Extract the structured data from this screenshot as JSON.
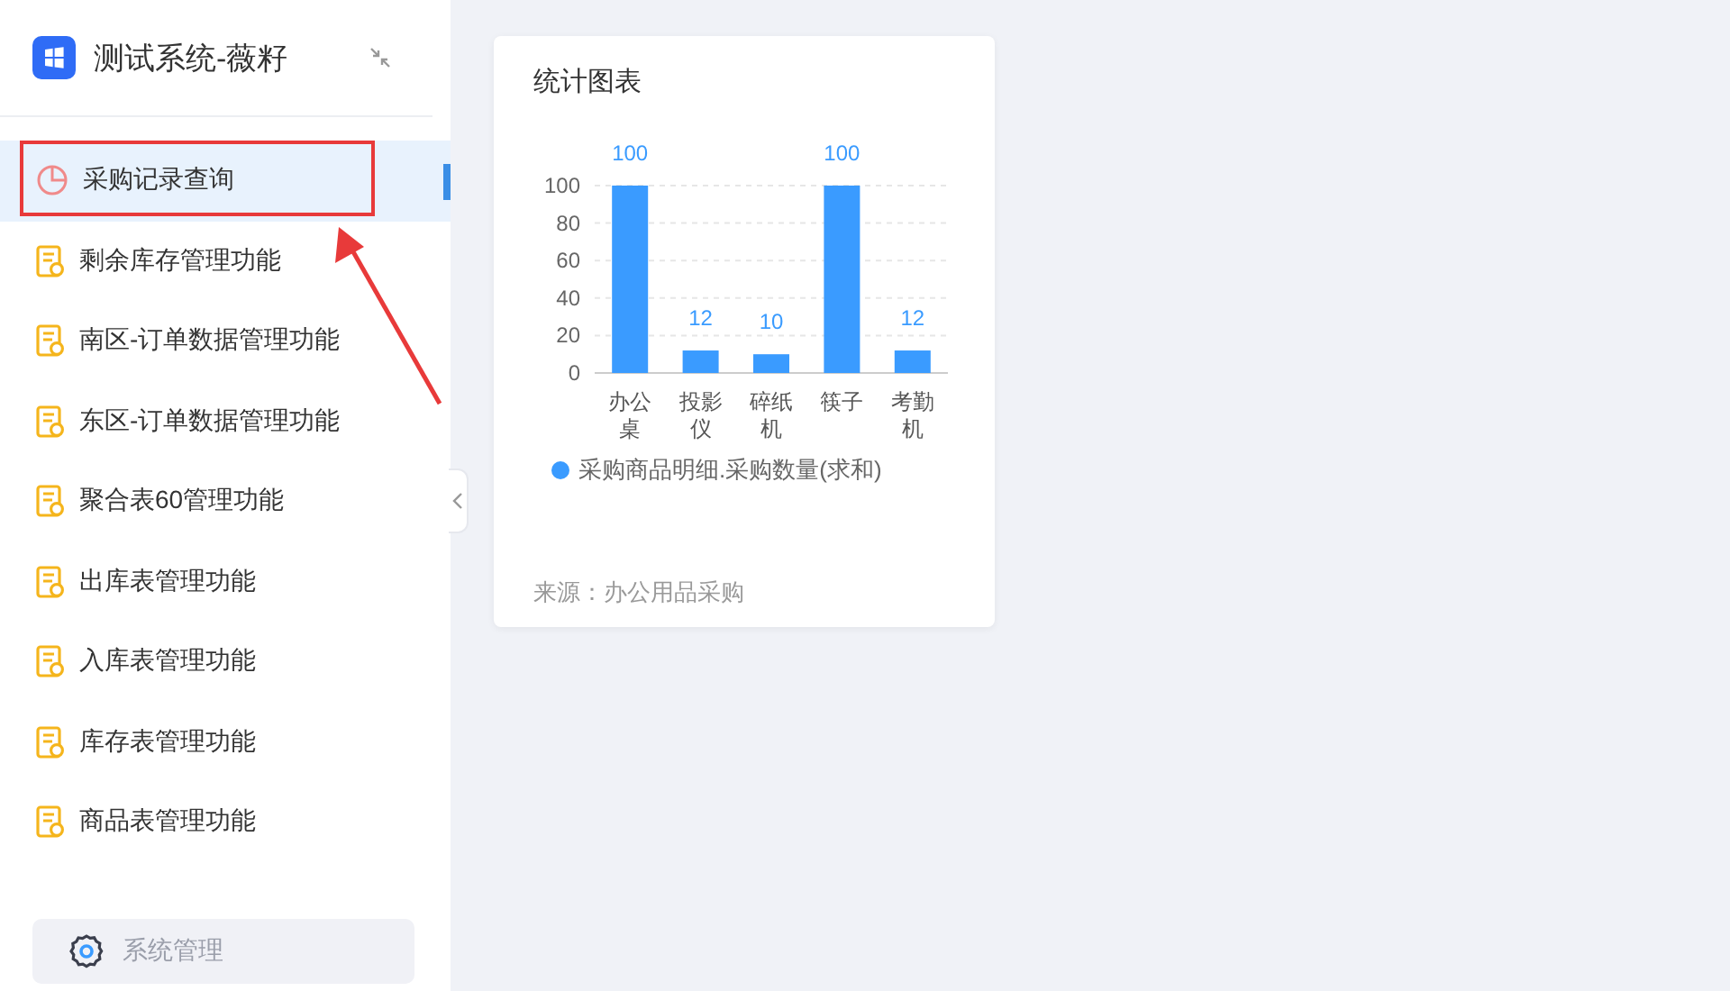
{
  "sidebar": {
    "app_title": "测试系统-薇籽",
    "items": [
      {
        "label": "采购记录查询",
        "kind": "chart",
        "selected": true
      },
      {
        "label": "剩余库存管理功能",
        "kind": "form",
        "selected": false
      },
      {
        "label": "南区-订单数据管理功能",
        "kind": "form",
        "selected": false
      },
      {
        "label": "东区-订单数据管理功能",
        "kind": "form",
        "selected": false
      },
      {
        "label": "聚合表60管理功能",
        "kind": "form",
        "selected": false
      },
      {
        "label": "出库表管理功能",
        "kind": "form",
        "selected": false
      },
      {
        "label": "入库表管理功能",
        "kind": "form",
        "selected": false
      },
      {
        "label": "库存表管理功能",
        "kind": "form",
        "selected": false
      },
      {
        "label": "商品表管理功能",
        "kind": "form",
        "selected": false
      }
    ],
    "footer_button": "系统管理"
  },
  "annotation": {
    "kind": "box-arrow"
  },
  "card": {
    "title": "统计图表",
    "source": "来源：办公用品采购",
    "chart_data": {
      "type": "bar",
      "categories": [
        "办公桌",
        "投影仪",
        "碎纸机",
        "筷子",
        "考勤机"
      ],
      "series": [
        {
          "name": "采购商品明细.采购数量(求和)",
          "color": "#3a9bff",
          "values": [
            100,
            12,
            10,
            100,
            12
          ]
        }
      ],
      "ylim": [
        0,
        100
      ],
      "yticks": [
        0,
        20,
        40,
        60,
        80,
        100
      ],
      "grid": true,
      "data_labels": true
    }
  }
}
